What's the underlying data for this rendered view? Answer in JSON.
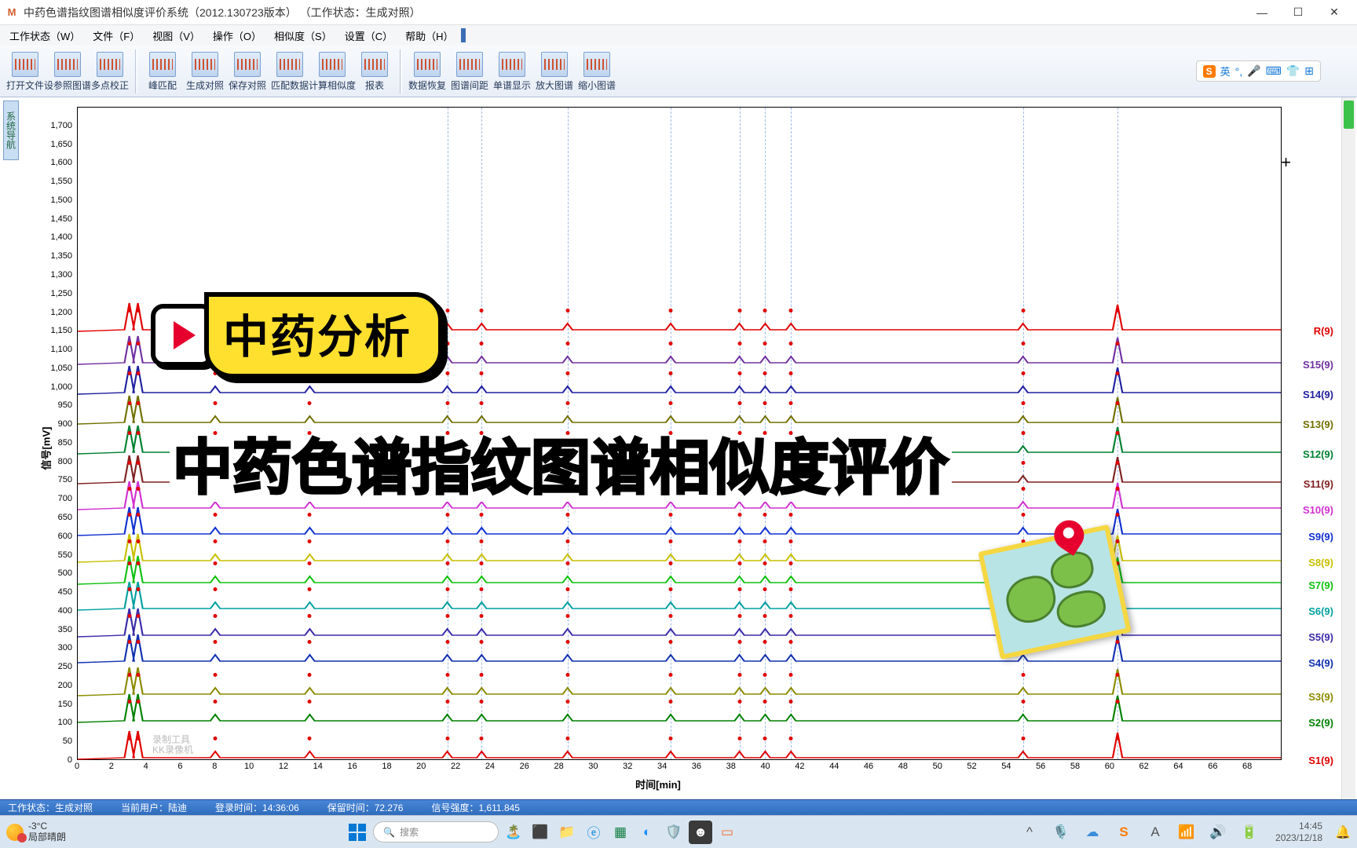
{
  "window": {
    "title": "中药色谱指纹图谱相似度评价系统（2012.130723版本）  （工作状态：生成对照）",
    "app_icon_text": "M"
  },
  "menu": {
    "items": [
      "工作状态（W）",
      "文件（F）",
      "视图（V）",
      "操作（O）",
      "相似度（S）",
      "设置（C）",
      "帮助（H）"
    ]
  },
  "toolbar": {
    "groups": [
      [
        "打开文件",
        "设参照图谱",
        "多点校正"
      ],
      [
        "峰匹配",
        "生成对照",
        "保存对照",
        "匹配数据",
        "计算相似度",
        "报表"
      ],
      [
        "数据恢复",
        "图谱间距",
        "单谱显示",
        "放大图谱",
        "缩小图谱"
      ]
    ],
    "ime_text": "英"
  },
  "side_tab": "系统导航",
  "chart_data": {
    "type": "line",
    "title": "",
    "xlabel": "时间[min]",
    "ylabel": "信号[mV]",
    "xlim": [
      0,
      70
    ],
    "ylim": [
      0,
      1750
    ],
    "x_ticks": [
      0,
      2,
      4,
      6,
      8,
      10,
      12,
      14,
      16,
      18,
      20,
      22,
      24,
      26,
      28,
      30,
      32,
      34,
      36,
      38,
      40,
      42,
      44,
      46,
      48,
      50,
      52,
      54,
      56,
      58,
      60,
      62,
      64,
      66,
      68
    ],
    "y_ticks": [
      0,
      50,
      100,
      150,
      200,
      250,
      300,
      350,
      400,
      450,
      500,
      550,
      600,
      650,
      700,
      750,
      800,
      850,
      900,
      950,
      1000,
      1050,
      1100,
      1150,
      1200,
      1250,
      1300,
      1350,
      1400,
      1450,
      1500,
      1550,
      1600,
      1650,
      1700
    ],
    "series": [
      {
        "name": "S1(9)",
        "color": "#e00000",
        "offset": 0
      },
      {
        "name": "S2(9)",
        "color": "#008000",
        "offset": 100
      },
      {
        "name": "S3(9)",
        "color": "#8a8a00",
        "offset": 170
      },
      {
        "name": "S4(9)",
        "color": "#1030b0",
        "offset": 260
      },
      {
        "name": "S5(9)",
        "color": "#3a2aa8",
        "offset": 330
      },
      {
        "name": "S6(9)",
        "color": "#00a0a0",
        "offset": 400
      },
      {
        "name": "S7(9)",
        "color": "#10c010",
        "offset": 470
      },
      {
        "name": "S8(9)",
        "color": "#c8c000",
        "offset": 530
      },
      {
        "name": "S9(9)",
        "color": "#1030d0",
        "offset": 600
      },
      {
        "name": "S10(9)",
        "color": "#d030d0",
        "offset": 670
      },
      {
        "name": "S11(9)",
        "color": "#802020",
        "offset": 740
      },
      {
        "name": "S12(9)",
        "color": "#008030",
        "offset": 820
      },
      {
        "name": "S13(9)",
        "color": "#707000",
        "offset": 900
      },
      {
        "name": "S14(9)",
        "color": "#2020a0",
        "offset": 980
      },
      {
        "name": "S15(9)",
        "color": "#7030a0",
        "offset": 1060
      },
      {
        "name": "R(9)",
        "color": "#e00000",
        "offset": 1150
      }
    ],
    "common_peaks_rt": [
      3.0,
      3.5,
      8.0,
      13.5,
      21.5,
      23.5,
      28.5,
      34.5,
      38.5,
      40.0,
      41.5,
      55.0,
      60.5
    ],
    "vlines_rt": [
      21.5,
      23.5,
      28.5,
      34.5,
      38.5,
      40.0,
      41.5,
      55.0,
      60.5
    ],
    "cursor": {
      "time": 72.276,
      "intensity": 1611.845
    }
  },
  "watermark": {
    "line1": "录制工具",
    "line2": "KK录像机"
  },
  "overlay": {
    "badge_text": "中药分析",
    "title_text": "中药色谱指纹图谱相似度评价"
  },
  "statusbar": {
    "work_state_label": "工作状态：生成对照",
    "user_label": "当前用户：陆迪",
    "login_label": "登录时间：14:36:06",
    "rt_label": "保留时间：72.276",
    "intensity_label": "信号强度：1,611.845"
  },
  "taskbar": {
    "temp": "-3°C",
    "weather": "局部晴朗",
    "search_placeholder": "搜索",
    "time": "14:45",
    "date": "2023/12/18"
  }
}
